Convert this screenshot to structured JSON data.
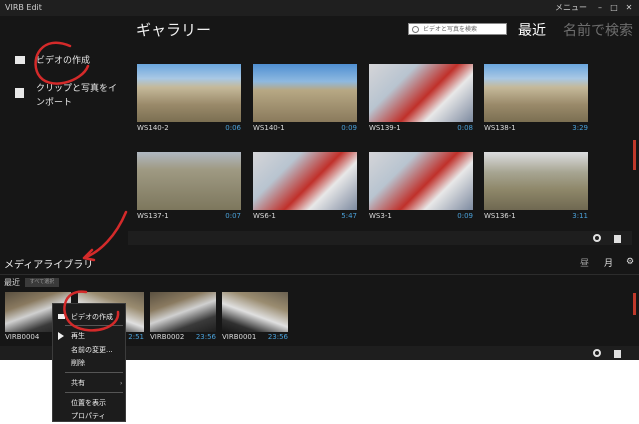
{
  "window": {
    "title": "VIRB Edit",
    "menu_label": "メニュー",
    "minimize": "–",
    "maximize": "□",
    "close": "✕"
  },
  "sidebar": {
    "items": [
      {
        "label": "ビデオの作成",
        "icon": "video-camera-icon"
      },
      {
        "label": "クリップと写真をインポート",
        "icon": "import-icon"
      }
    ]
  },
  "gallery": {
    "title": "ギャラリー",
    "search_placeholder": "ビデオと写真を検索",
    "sort_recent": "最近",
    "sort_name": "名前で検索",
    "clips": [
      {
        "name": "WS140-2",
        "duration": "0:06",
        "style": "t-sky"
      },
      {
        "name": "WS140-1",
        "duration": "0:09",
        "style": "t-sky2"
      },
      {
        "name": "WS139-1",
        "duration": "0:08",
        "style": "t-red"
      },
      {
        "name": "WS138-1",
        "duration": "3:29",
        "style": "t-sky"
      },
      {
        "name": "WS137-1",
        "duration": "0:07",
        "style": "t-earth2"
      },
      {
        "name": "WS6-1",
        "duration": "5:47",
        "style": "t-red"
      },
      {
        "name": "WS3-1",
        "duration": "0:09",
        "style": "t-red"
      },
      {
        "name": "WS136-1",
        "duration": "3:11",
        "style": "t-earth"
      }
    ]
  },
  "library": {
    "title": "メディアライブラリ",
    "view_day": "昼",
    "view_month": "月",
    "recent_label": "最近",
    "select_all": "すべて選択",
    "clips": [
      {
        "name": "VIRB0004",
        "duration": "",
        "style": "t-car"
      },
      {
        "name": "",
        "duration": "2:51",
        "style": "t-car2"
      },
      {
        "name": "VIRB0002",
        "duration": "23:56",
        "style": "t-car"
      },
      {
        "name": "VIRB0001",
        "duration": "23:56",
        "style": "t-car2"
      }
    ]
  },
  "context_menu": {
    "items": [
      {
        "label": "ビデオの作成"
      },
      {
        "label": "再生"
      },
      {
        "label": "名前の変更..."
      },
      {
        "label": "削除"
      },
      {
        "label": "共有"
      },
      {
        "label": "位置を表示"
      },
      {
        "label": "プロパティ"
      }
    ]
  },
  "colors": {
    "accent": "#c0392b",
    "duration": "#4aa0d8",
    "background": "#161616"
  }
}
